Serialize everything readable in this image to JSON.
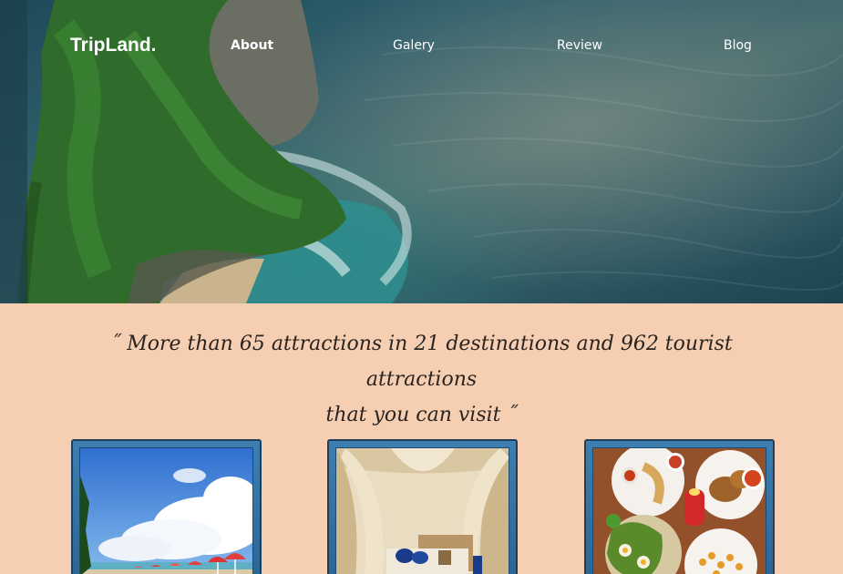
{
  "nav": {
    "logo": "TripLand.",
    "links": [
      {
        "label": "About",
        "active": true
      },
      {
        "label": "Galery",
        "active": false
      },
      {
        "label": "Review",
        "active": false
      },
      {
        "label": "Blog",
        "active": false
      }
    ]
  },
  "hero": {
    "image": "aerial-ocean-cliff-photo"
  },
  "quote": {
    "line1": "˝ More than 65 attractions in 21 destinations and 962 tourist attractions",
    "line2": "that you can visit ˝"
  },
  "cards": [
    {
      "image": "beach-umbrellas-photo"
    },
    {
      "image": "hotel-room-canopy-bed-photo"
    },
    {
      "image": "traditional-food-plates-photo"
    }
  ],
  "colors": {
    "page_background": "#f6cfb3",
    "card_frame": "#2f6c9c",
    "text": "#2a2420",
    "nav_text": "#ffffff"
  }
}
